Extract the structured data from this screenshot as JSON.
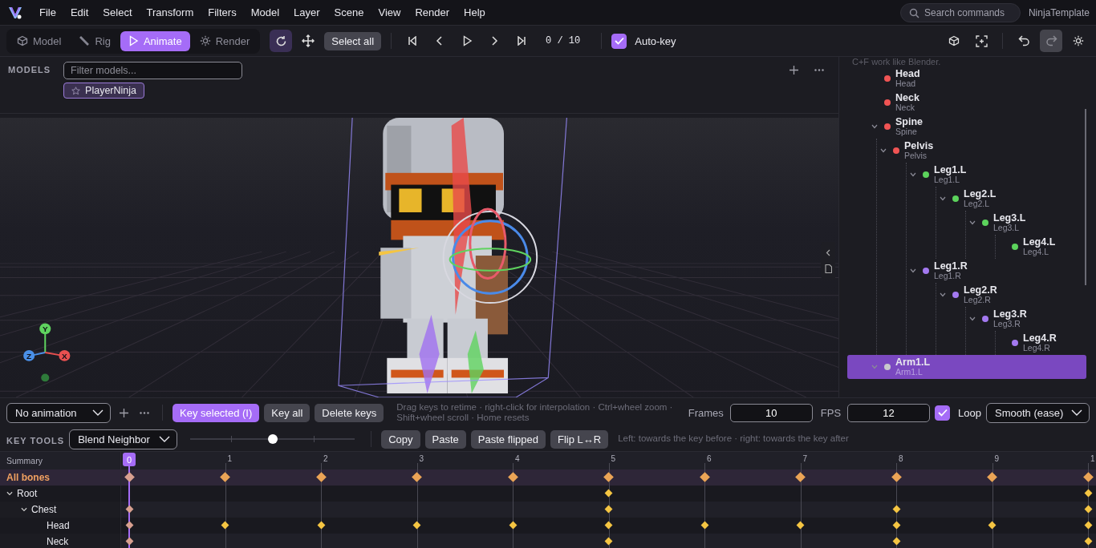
{
  "menu": {
    "items": [
      "File",
      "Edit",
      "Select",
      "Transform",
      "Filters",
      "Model",
      "Layer",
      "Scene",
      "View",
      "Render",
      "Help"
    ],
    "search": {
      "placeholder": "Search commands"
    },
    "project": "NinjaTemplate"
  },
  "toolbar": {
    "modes": [
      {
        "label": "Model",
        "selected": false
      },
      {
        "label": "Rig",
        "selected": false
      },
      {
        "label": "Animate",
        "selected": true
      },
      {
        "label": "Render",
        "selected": false
      }
    ],
    "tools": [
      {
        "selected": true
      },
      {
        "selected": false
      }
    ],
    "select_all": "Select all",
    "frame_counter": "0 / 10",
    "auto_key": {
      "label": "Auto-key",
      "checked": true
    },
    "history": [
      {
        "disabled": false
      },
      {
        "disabled": true
      }
    ]
  },
  "models": {
    "label": "MODELS",
    "filter": {
      "placeholder": "Filter models..."
    },
    "items": [
      {
        "name": "PlayerNinja",
        "starred": false
      }
    ]
  },
  "viewport": {
    "axes": [
      {
        "label": "Y",
        "color": "#5fd35f"
      },
      {
        "label": "Z",
        "color": "#4a90e8"
      },
      {
        "label": "X",
        "color": "#e85050"
      }
    ]
  },
  "outliner": {
    "note": "C+F work like Blender.",
    "bones": [
      {
        "name": "Head",
        "subtitle": "Head",
        "color": "#f05454",
        "selected": false
      },
      {
        "name": "Neck",
        "subtitle": "Neck",
        "color": "#f05454",
        "selected": false
      },
      {
        "name": "Spine",
        "subtitle": "Spine",
        "color": "#f05454",
        "selected": false,
        "expanded": true,
        "children": [
          {
            "name": "Pelvis",
            "subtitle": "Pelvis",
            "color": "#f05454",
            "selected": false,
            "expanded": true,
            "children": [
              {
                "name": "Leg1.L",
                "subtitle": "Leg1.L",
                "color": "#5cd35c",
                "selected": false,
                "expanded": true,
                "children": [
                  {
                    "name": "Leg2.L",
                    "subtitle": "Leg2.L",
                    "color": "#5cd35c",
                    "selected": false,
                    "expanded": true,
                    "children": [
                      {
                        "name": "Leg3.L",
                        "subtitle": "Leg3.L",
                        "color": "#5cd35c",
                        "selected": false,
                        "expanded": true,
                        "children": [
                          {
                            "name": "Leg4.L",
                            "subtitle": "Leg4.L",
                            "color": "#5cd35c",
                            "selected": false
                          }
                        ]
                      }
                    ]
                  }
                ]
              },
              {
                "name": "Leg1.R",
                "subtitle": "Leg1.R",
                "color": "#a379f0",
                "selected": false,
                "expanded": true,
                "children": [
                  {
                    "name": "Leg2.R",
                    "subtitle": "Leg2.R",
                    "color": "#a379f0",
                    "selected": false,
                    "expanded": true,
                    "children": [
                      {
                        "name": "Leg3.R",
                        "subtitle": "Leg3.R",
                        "color": "#a379f0",
                        "selected": false,
                        "expanded": true,
                        "children": [
                          {
                            "name": "Leg4.R",
                            "subtitle": "Leg4.R",
                            "color": "#a379f0",
                            "selected": false
                          }
                        ]
                      }
                    ]
                  }
                ]
              }
            ]
          }
        ]
      },
      {
        "name": "Arm1.L",
        "subtitle": "Arm1.L",
        "color": "#c8c8cc",
        "selected": true,
        "expanded": true
      }
    ]
  },
  "animation": {
    "clip": "No animation",
    "buttons": [
      {
        "label": "Key selected (I)",
        "primary": true
      },
      {
        "label": "Key all",
        "primary": false
      },
      {
        "label": "Delete keys",
        "primary": false
      }
    ],
    "hint": [
      "Drag keys to retime · right-click for interpolation · Ctrl+wheel zoom ·",
      "Shift+wheel scroll · Home resets"
    ],
    "frames": {
      "label": "Frames",
      "value": "10"
    },
    "fps": {
      "label": "FPS",
      "value": "12"
    },
    "loop": {
      "label": "Loop",
      "checked": true
    },
    "easing": "Smooth (ease)"
  },
  "key_tools": {
    "label": "KEY TOOLS",
    "mode": "Blend Neighbor",
    "blend": {
      "level": 0.5
    },
    "buttons": [
      "Copy",
      "Paste",
      "Paste flipped",
      "Flip L↔R"
    ],
    "hint": "Left: towards the key before · right: towards the key after"
  },
  "timeline": {
    "summary_label": "Summary",
    "ruler": [
      {
        "label": "0",
        "selected": true
      },
      {
        "label": "1",
        "selected": false
      },
      {
        "label": "2",
        "selected": false
      },
      {
        "label": "3",
        "selected": false
      },
      {
        "label": "4",
        "selected": false
      },
      {
        "label": "5",
        "selected": false
      },
      {
        "label": "6",
        "selected": false
      },
      {
        "label": "7",
        "selected": false
      },
      {
        "label": "8",
        "selected": false
      },
      {
        "label": "9",
        "selected": false
      },
      {
        "label": "1",
        "selected": false
      }
    ],
    "rows": [
      {
        "label": "All bones",
        "kind": "summary",
        "keys": [
          true,
          true,
          true,
          true,
          true,
          true,
          true,
          true,
          true,
          true,
          true
        ]
      },
      {
        "label": "Root",
        "kind": "bone",
        "expanded": true,
        "keys": [
          false,
          false,
          false,
          false,
          false,
          true,
          false,
          false,
          false,
          false,
          true
        ],
        "children": [
          {
            "label": "Chest",
            "kind": "bone",
            "expanded": true,
            "keys": [
              true,
              false,
              false,
              false,
              false,
              true,
              false,
              false,
              true,
              false,
              true
            ],
            "children": [
              {
                "label": "Head",
                "kind": "bone",
                "keys": [
                  true,
                  true,
                  true,
                  true,
                  true,
                  true,
                  true,
                  true,
                  true,
                  true,
                  true
                ]
              },
              {
                "label": "Neck",
                "kind": "bone",
                "keys": [
                  true,
                  false,
                  false,
                  false,
                  false,
                  true,
                  false,
                  false,
                  true,
                  false,
                  true
                ]
              }
            ]
          }
        ]
      }
    ]
  }
}
